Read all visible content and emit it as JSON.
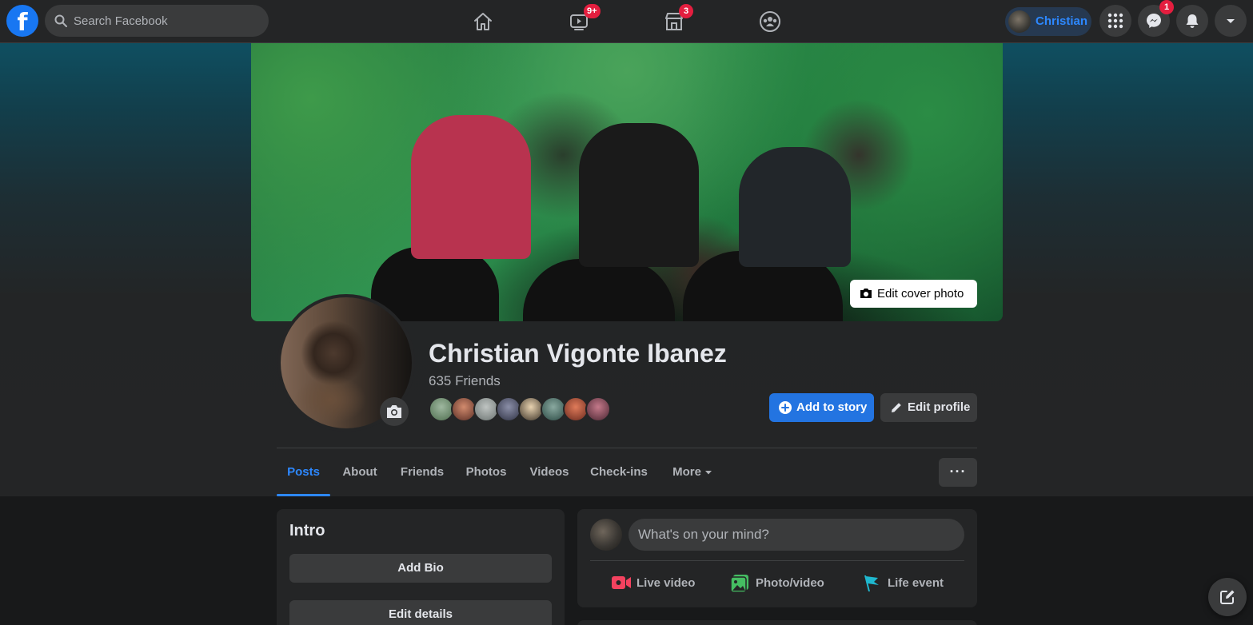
{
  "nav": {
    "search_placeholder": "Search Facebook",
    "logo_letter": "f",
    "icons": [
      "home-icon",
      "watch-icon",
      "marketplace-icon",
      "groups-icon"
    ],
    "watch_badge": "9+",
    "marketplace_badge": "3",
    "user_name": "Christian",
    "messenger_badge": "1"
  },
  "cover": {
    "edit_label": "Edit cover photo"
  },
  "profile": {
    "name": "Christian Vigonte Ibanez",
    "friends": "635 Friends",
    "add_story": "Add to story",
    "edit_profile": "Edit profile"
  },
  "tabs": {
    "items": [
      "Posts",
      "About",
      "Friends",
      "Photos",
      "Videos",
      "Check-ins",
      "More"
    ],
    "active": "Posts",
    "more_options": "···"
  },
  "intro": {
    "title": "Intro",
    "add_bio": "Add Bio",
    "edit_details": "Edit details"
  },
  "composer": {
    "placeholder": "What's on your mind?",
    "live": "Live video",
    "photo": "Photo/video",
    "life": "Life event"
  },
  "colors": {
    "accent": "#2d88ff",
    "primary_button": "#2374e1",
    "badge": "#e41e3f",
    "live": "#f3425f",
    "photo": "#45bd62",
    "life": "#1fb8cf"
  }
}
